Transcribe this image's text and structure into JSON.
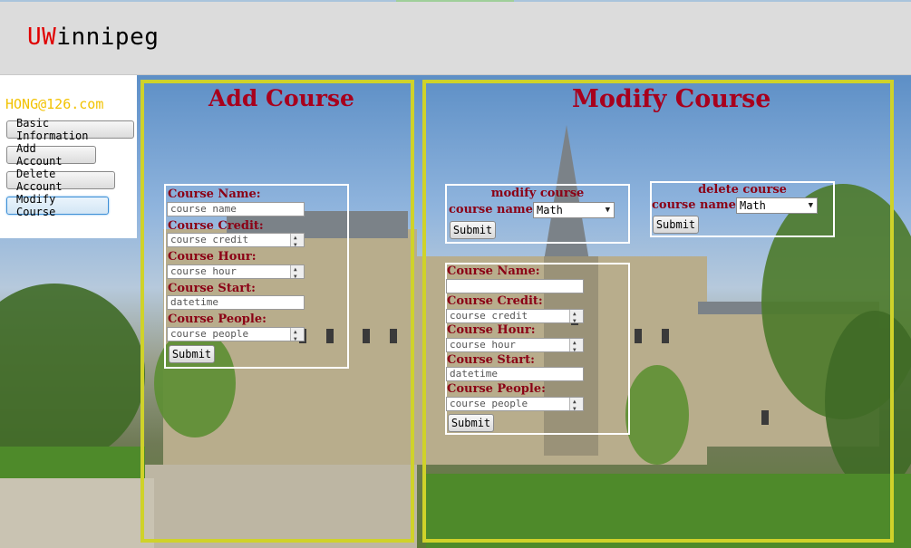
{
  "header": {
    "logo_prefix": "UW",
    "logo_rest": "innipeg"
  },
  "sidebar": {
    "email": "HONG@126.com",
    "items": [
      {
        "label": "Basic Information"
      },
      {
        "label": "Add Account"
      },
      {
        "label": "Delete Account"
      },
      {
        "label": "Modify Course"
      }
    ]
  },
  "add_course": {
    "title": "Add Course",
    "fields": [
      {
        "label": "Course Name:",
        "placeholder": "course name"
      },
      {
        "label": "Course Credit:",
        "placeholder": "course credit"
      },
      {
        "label": "Course Hour:",
        "placeholder": "course hour"
      },
      {
        "label": "Course Start:",
        "placeholder": "datetime"
      },
      {
        "label": "Course People:",
        "placeholder": "course people"
      }
    ],
    "submit_label": "Submit"
  },
  "modify_course": {
    "title": "Modify Course",
    "modify_box": {
      "heading": "modify course",
      "select_label": "course name:",
      "selected": "Math",
      "submit_label": "Submit"
    },
    "delete_box": {
      "heading": "delete course",
      "select_label": "course name:",
      "selected": "Math",
      "submit_label": "Submit"
    },
    "fields": [
      {
        "label": "Course Name:",
        "placeholder": ""
      },
      {
        "label": "Course Credit:",
        "placeholder": "course credit"
      },
      {
        "label": "Course Hour:",
        "placeholder": "course hour"
      },
      {
        "label": "Course Start:",
        "placeholder": "datetime"
      },
      {
        "label": "Course People:",
        "placeholder": "course people"
      }
    ],
    "submit_label": "Submit"
  },
  "colors": {
    "frame": "#cfd22a",
    "title": "#a8001d",
    "label": "#8b0015",
    "email": "#f2c200",
    "logo_accent": "#e00000"
  }
}
